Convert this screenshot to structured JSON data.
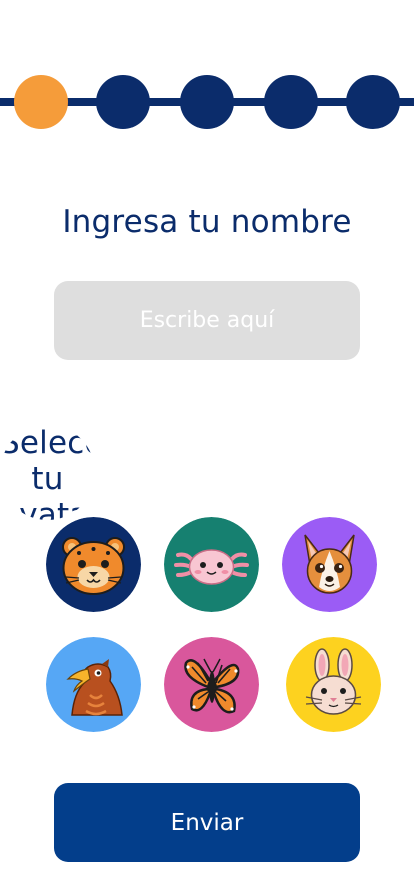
{
  "stepper": {
    "total_steps": 5,
    "current_step": 1,
    "active_color": "#f59c3a",
    "inactive_color": "#0b2c6b"
  },
  "name_section": {
    "title": "Ingresa tu nombre",
    "input_value": "",
    "input_placeholder": "Escribe aquí"
  },
  "avatar_section": {
    "title": "Selecciona tu avatar",
    "avatars": [
      {
        "icon": "jaguar-icon",
        "background": "#0b2c6b"
      },
      {
        "icon": "axolotl-icon",
        "background": "#168070"
      },
      {
        "icon": "chihuahua-icon",
        "background": "#9b5cf5"
      },
      {
        "icon": "eagle-icon",
        "background": "#56a7f5"
      },
      {
        "icon": "butterfly-icon",
        "background": "#d9579c"
      },
      {
        "icon": "rabbit-icon",
        "background": "#fdd21f"
      }
    ]
  },
  "submit": {
    "label": "Enviar",
    "color": "#033e8b"
  }
}
